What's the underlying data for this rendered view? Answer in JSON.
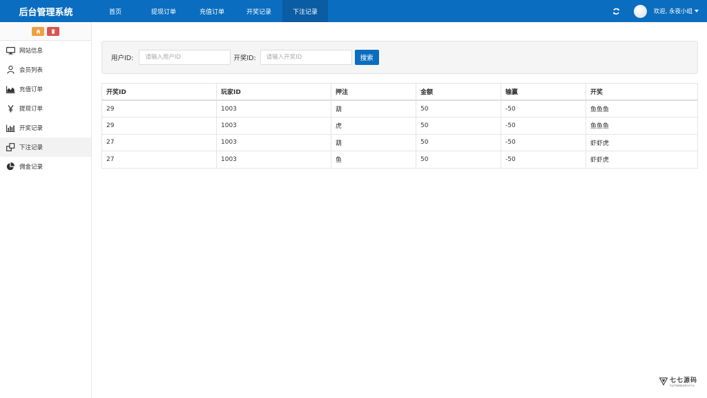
{
  "app": {
    "title": "后台管理系统"
  },
  "nav": {
    "items": [
      {
        "label": "首页"
      },
      {
        "label": "提现订单"
      },
      {
        "label": "充值订单"
      },
      {
        "label": "开奖记录"
      },
      {
        "label": "下注记录"
      }
    ],
    "active_index": 4
  },
  "user": {
    "greeting": "欢迎, 永夜小组"
  },
  "icons": {
    "refresh": "refresh-icon",
    "caret": "caret-down-icon",
    "home": "home-icon",
    "trash": "trash-icon"
  },
  "sidebar": {
    "items": [
      {
        "label": "网站信息",
        "icon": "monitor-icon"
      },
      {
        "label": "会员列表",
        "icon": "user-icon"
      },
      {
        "label": "充值订单",
        "icon": "area-chart-icon"
      },
      {
        "label": "提现订单",
        "icon": "yen-icon"
      },
      {
        "label": "开奖记录",
        "icon": "bar-chart-icon"
      },
      {
        "label": "下注记录",
        "icon": "clone-icon"
      },
      {
        "label": "佣金记录",
        "icon": "pie-chart-icon"
      }
    ],
    "active_index": 5
  },
  "search": {
    "user_id_label": "用户ID:",
    "user_id_placeholder": "请输入用户ID",
    "draw_id_label": "开奖ID:",
    "draw_id_placeholder": "请输入开奖ID",
    "button_label": "搜索"
  },
  "table": {
    "headers": [
      "开奖ID",
      "玩家ID",
      "押注",
      "金额",
      "输赢",
      "开奖"
    ],
    "rows": [
      [
        "29",
        "1003",
        "葫",
        "50",
        "-50",
        "鱼鱼鱼"
      ],
      [
        "29",
        "1003",
        "虎",
        "50",
        "-50",
        "鱼鱼鱼"
      ],
      [
        "27",
        "1003",
        "葫",
        "50",
        "-50",
        "虾虾虎"
      ],
      [
        "27",
        "1003",
        "鱼",
        "50",
        "-50",
        "虾虾虎"
      ]
    ]
  },
  "watermark": {
    "main": "七七源码",
    "sub": "专业开发模板资源分享平台"
  },
  "colors": {
    "primary": "#0a6dbf",
    "home_button": "#f0a040",
    "trash_button": "#d9534f"
  }
}
